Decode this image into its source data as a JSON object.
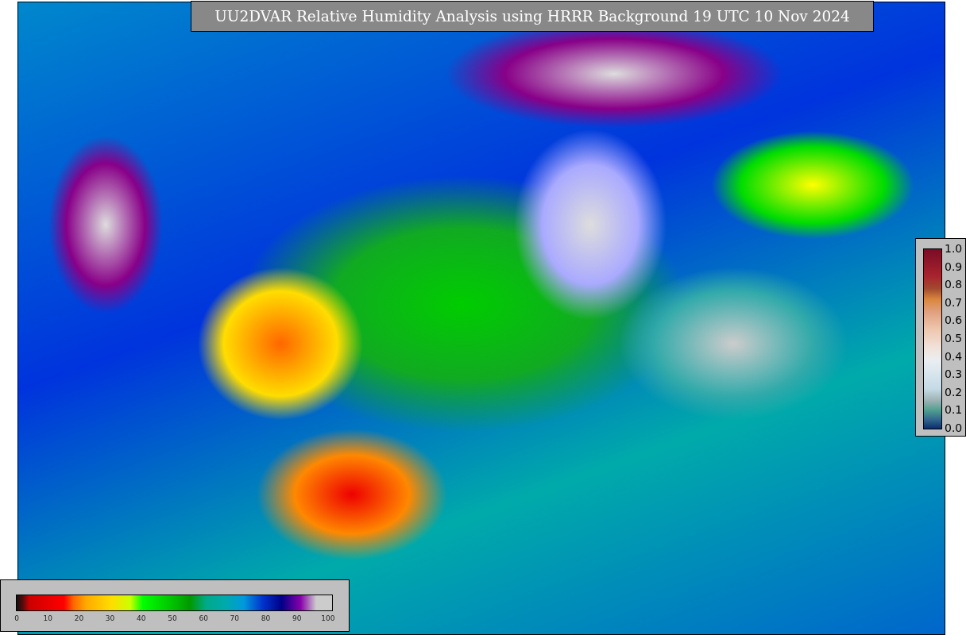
{
  "title": "UU2DVAR Relative Humidity Analysis using HRRR Background 19 UTC 10 Nov 2024",
  "side_colorbar": {
    "labels": [
      "1.0",
      "0.9",
      "0.8",
      "0.7",
      "0.6",
      "0.5",
      "0.4",
      "0.3",
      "0.2",
      "0.1",
      "0.0"
    ]
  },
  "bottom_colorbar": {
    "labels": [
      "0",
      "10",
      "20",
      "30",
      "40",
      "50",
      "60",
      "70",
      "80",
      "90",
      "100"
    ]
  }
}
